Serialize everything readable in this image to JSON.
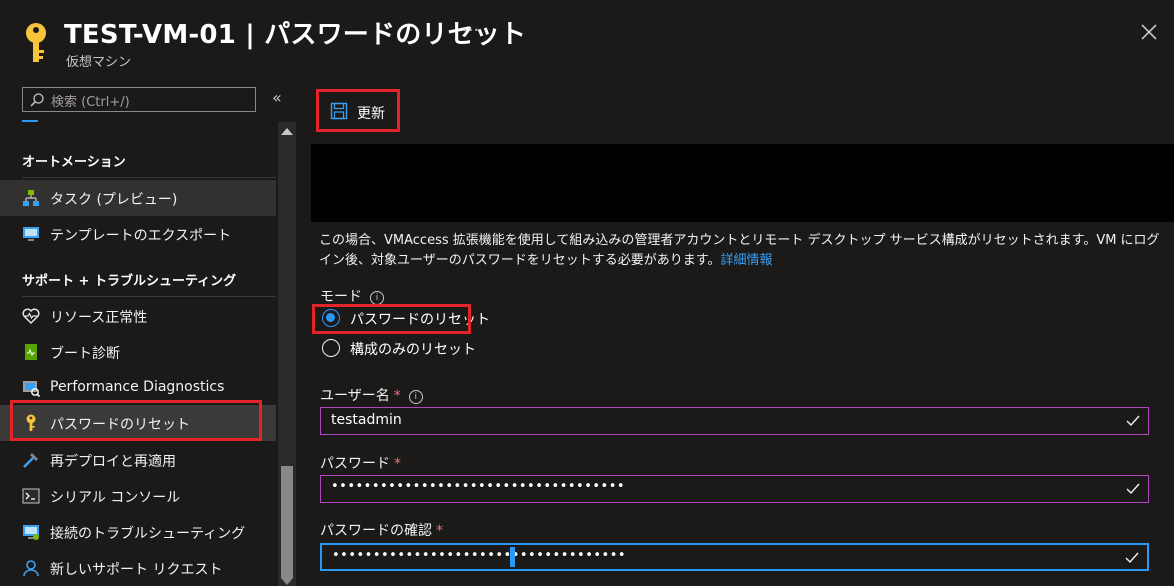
{
  "header": {
    "title": "TEST-VM-01 | パスワードのリセット",
    "subtitle": "仮想マシン",
    "more": "···"
  },
  "sidebar": {
    "search_placeholder": "検索 (Ctrl+/)",
    "collapse": "«",
    "sections": [
      {
        "title": "オートメーション"
      },
      {
        "title": "サポート + トラブルシューティング"
      }
    ],
    "items": [
      {
        "label": "タスク (プレビュー)",
        "icon": "tasks-icon"
      },
      {
        "label": "テンプレートのエクスポート",
        "icon": "export-template-icon"
      },
      {
        "label": "リソース正常性",
        "icon": "heart-pulse-icon"
      },
      {
        "label": "ブート診断",
        "icon": "boot-diagnostics-icon"
      },
      {
        "label": "Performance Diagnostics",
        "icon": "performance-diagnostics-icon"
      },
      {
        "label": "パスワードのリセット",
        "icon": "key-icon"
      },
      {
        "label": "再デプロイと再適用",
        "icon": "hammer-icon"
      },
      {
        "label": "シリアル コンソール",
        "icon": "console-icon"
      },
      {
        "label": "接続のトラブルシューティング",
        "icon": "connection-troubleshoot-icon"
      },
      {
        "label": "新しいサポート リクエスト",
        "icon": "support-person-icon"
      }
    ]
  },
  "toolbar": {
    "save_label": "更新"
  },
  "main": {
    "info_text": "この場合、VMAccess 拡張機能を使用して組み込みの管理者アカウントとリモート デスクトップ サービス構成がリセットされます。VM にログイン後、対象ユーザーのパスワードをリセットする必要があります。",
    "info_link": "詳細情報",
    "mode_label": "モード",
    "mode_options": [
      {
        "label": "パスワードのリセット",
        "selected": true
      },
      {
        "label": "構成のみのリセット",
        "selected": false
      }
    ],
    "username_label": "ユーザー名",
    "username_value": "testadmin",
    "password_label": "パスワード",
    "password_value": "••••••••••••••••••••••••••••••••••••",
    "confirm_label": "パスワードの確認",
    "confirm_value": "••••••••••••••••••••••••••••••••••••",
    "required_mark": "*",
    "info_glyph": "i"
  },
  "colors": {
    "background": "#1b1a19",
    "accent": "#2899f5",
    "highlight": "#e3242b",
    "input_border": "#b146c2",
    "required": "#f1707b",
    "key_gold": "#f8c53a"
  }
}
